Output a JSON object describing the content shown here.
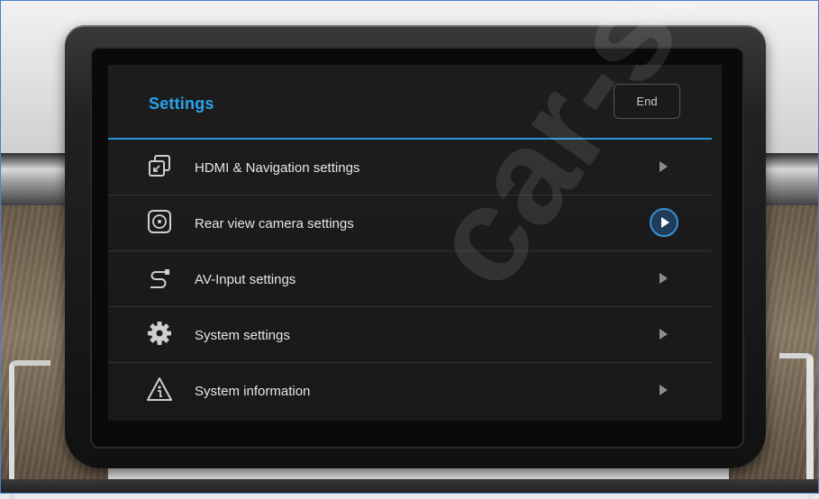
{
  "screen": {
    "title": "Settings",
    "end_button_label": "End"
  },
  "menu": {
    "items": [
      {
        "label": "HDMI & Navigation settings",
        "icon": "hdmi-icon",
        "active": false
      },
      {
        "label": "Rear view camera settings",
        "icon": "camera-icon",
        "active": true
      },
      {
        "label": "AV-Input settings",
        "icon": "cable-icon",
        "active": false
      },
      {
        "label": "System settings",
        "icon": "gear-icon",
        "active": false
      },
      {
        "label": "System information",
        "icon": "info-icon",
        "active": false
      }
    ]
  },
  "watermark": "car-sol",
  "colors": {
    "accent": "#29a3ec",
    "screen_bg": "#1b1b1b",
    "text": "#e6e6e6"
  }
}
